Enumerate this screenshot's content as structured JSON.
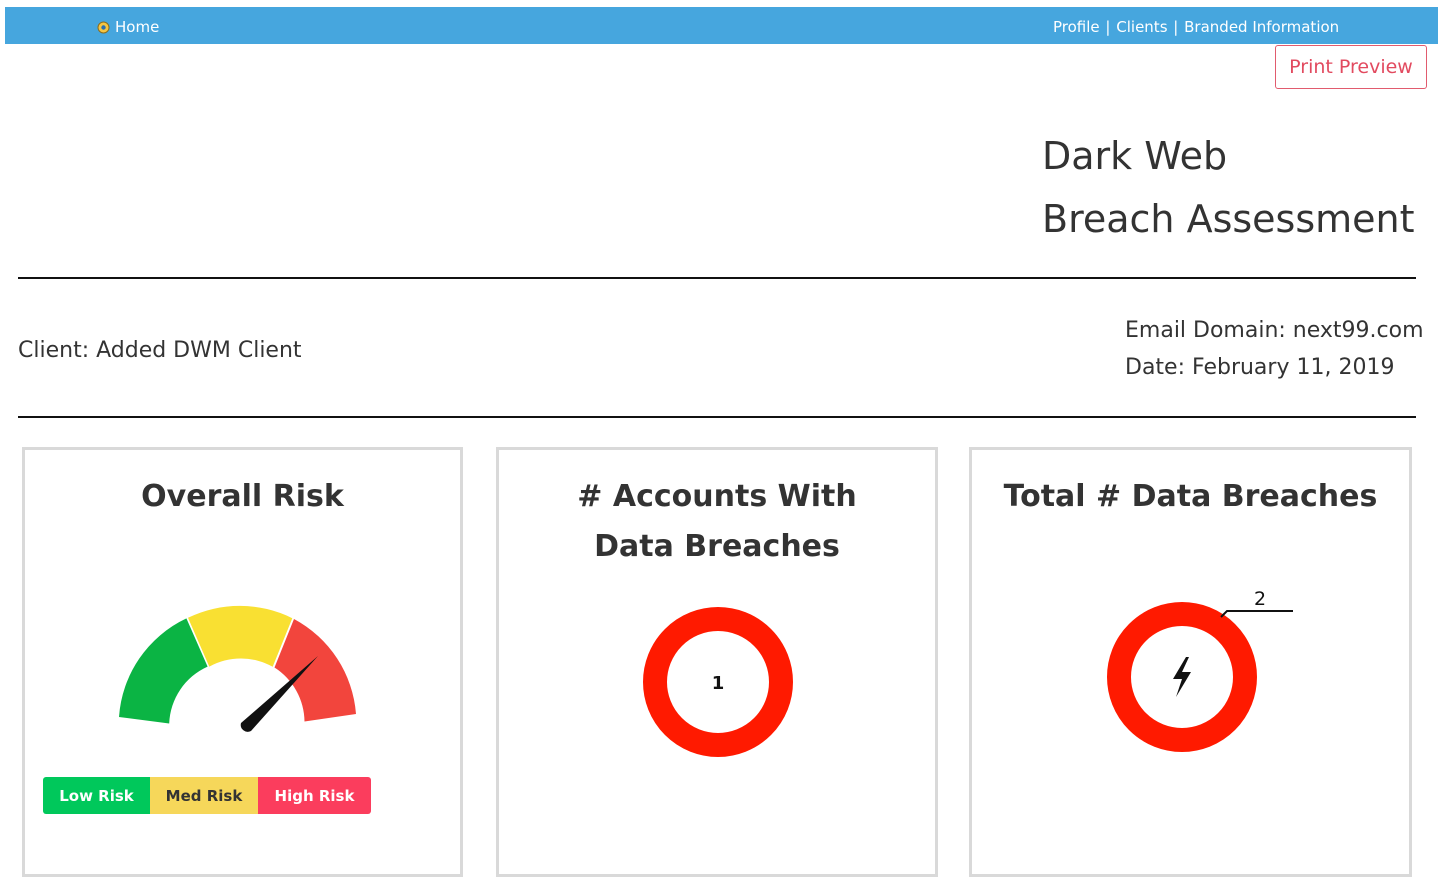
{
  "topbar": {
    "home_label": "Home",
    "links": [
      "Profile",
      "Clients",
      "Branded Information"
    ],
    "separator": "|"
  },
  "print_label": "Print Preview",
  "report": {
    "title_line1": "Dark Web",
    "title_line2": "Breach Assessment",
    "client": "Client: Added DWM Client",
    "email_domain": "Email Domain: next99.com",
    "date": "Date: February 11, 2019"
  },
  "cards": {
    "overall_risk": {
      "title": "Overall Risk",
      "level": "High Risk",
      "legend": [
        "Low Risk",
        "Med Risk",
        "High Risk"
      ],
      "colors": {
        "low": "#0bb444",
        "med": "#f9e032",
        "high": "#f2453d"
      }
    },
    "accounts": {
      "title": "# Accounts With Data Breaches",
      "value": "1",
      "ring_color": "#ff1a00"
    },
    "breaches": {
      "title": "Total # Data Breaches",
      "value": "2",
      "icon": "lightning-bolt-icon",
      "ring_color": "#ff1a00"
    }
  }
}
